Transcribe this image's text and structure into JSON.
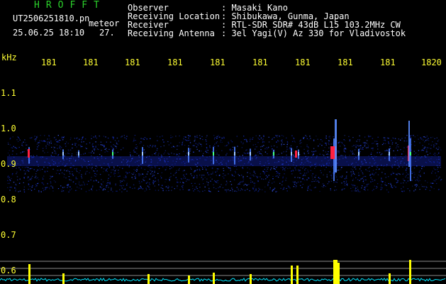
{
  "header": {
    "logo": "HROFFT",
    "filename": "UT2506251810.pn",
    "mode": "meteor",
    "datetime": "25.06.25 18:10",
    "counter": "27.",
    "info": [
      {
        "label": "Observer",
        "value": ": Masaki Kano"
      },
      {
        "label": "Receiving Location",
        "value": ": Shibukawa, Gunma, Japan"
      },
      {
        "label": "Receiver",
        "value": ": RTL-SDR SDR# 43dB L15 103.2MHz CW"
      },
      {
        "label": "Receiving Antenna",
        "value": ": 3el Yagi(V) Az 330 for Vladivostok"
      }
    ]
  },
  "axis": {
    "unit": "kHz",
    "time_ticks": [
      "181",
      "181",
      "181",
      "181",
      "181",
      "181",
      "181",
      "181",
      "181",
      "1820"
    ],
    "freq_ticks": [
      "1.1",
      "1.0",
      "0.9",
      "0.8",
      "0.7",
      "0.6"
    ]
  },
  "colors": {
    "text": "#ffffff",
    "logo": "#2bd12b",
    "ticks": "#ffff33",
    "power_trace": "#00e5ff",
    "power_peaks": "#ffff00",
    "echo_hot": "#ff2040",
    "noise": "#1a2fd0",
    "background": "#000000"
  }
}
